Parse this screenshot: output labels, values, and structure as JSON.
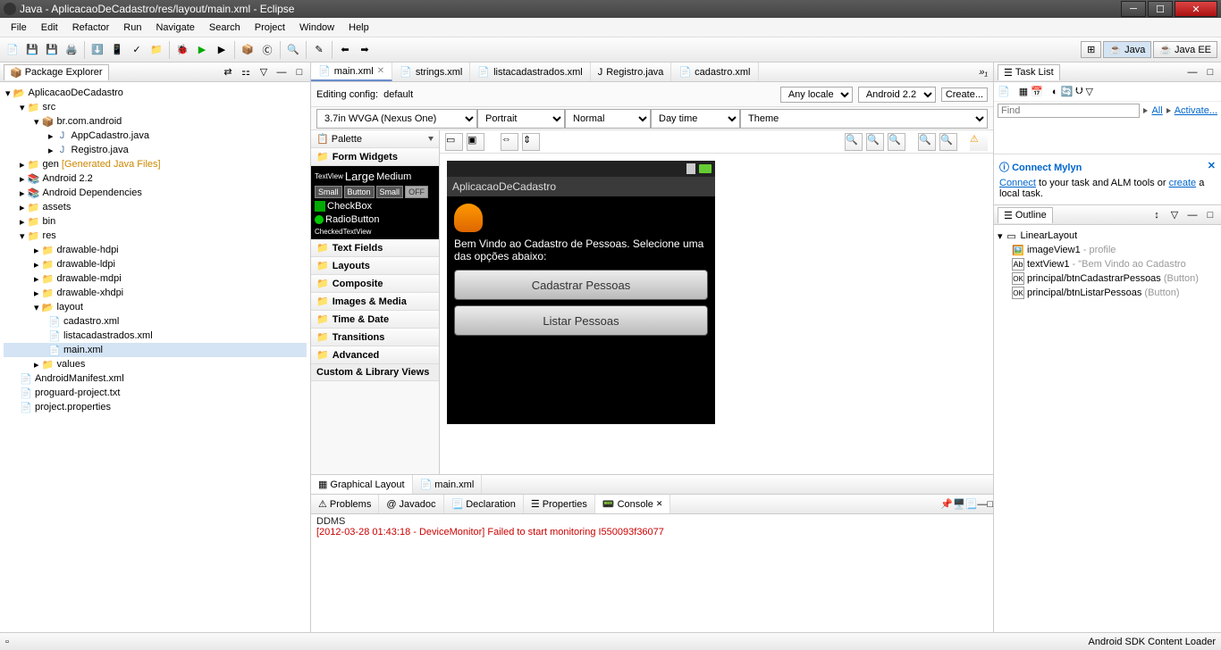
{
  "window": {
    "title": "Java - AplicacaoDeCadastro/res/layout/main.xml - Eclipse"
  },
  "menu": [
    "File",
    "Edit",
    "Refactor",
    "Run",
    "Navigate",
    "Search",
    "Project",
    "Window",
    "Help"
  ],
  "perspectives": {
    "java": "Java",
    "javaee": "Java EE"
  },
  "packageExplorer": {
    "title": "Package Explorer",
    "nodes": {
      "project": "AplicacaoDeCadastro",
      "src": "src",
      "pkg": "br.com.android",
      "file1": "AppCadastro.java",
      "file2": "Registro.java",
      "gen": "gen",
      "genSuffix": "[Generated Java Files]",
      "android22": "Android 2.2",
      "deps": "Android Dependencies",
      "assets": "assets",
      "bin": "bin",
      "res": "res",
      "hdpi": "drawable-hdpi",
      "ldpi": "drawable-ldpi",
      "mdpi": "drawable-mdpi",
      "xhdpi": "drawable-xhdpi",
      "layout": "layout",
      "cadastro": "cadastro.xml",
      "lista": "listacadastrados.xml",
      "mainxml": "main.xml",
      "values": "values",
      "manifest": "AndroidManifest.xml",
      "proguard": "proguard-project.txt",
      "props": "project.properties"
    }
  },
  "editorTabs": [
    {
      "label": "main.xml",
      "active": true
    },
    {
      "label": "strings.xml"
    },
    {
      "label": "listacadastrados.xml"
    },
    {
      "label": "Registro.java"
    },
    {
      "label": "cadastro.xml"
    }
  ],
  "editorConfig": {
    "label": "Editing config:",
    "value": "default",
    "locale": "Any locale",
    "target": "Android 2.2",
    "create": "Create...",
    "device": "3.7in WVGA (Nexus One)",
    "orient": "Portrait",
    "dock": "Normal",
    "daynight": "Day time",
    "theme": "Theme"
  },
  "palette": {
    "title": "Palette",
    "cats": [
      "Form Widgets",
      "Text Fields",
      "Layouts",
      "Composite",
      "Images & Media",
      "Time & Date",
      "Transitions",
      "Advanced",
      "Custom & Library Views"
    ],
    "widgets": {
      "textview": "TextView",
      "large": "Large",
      "medium": "Medium",
      "small": "Small",
      "button": "Button",
      "small2": "Small",
      "off": "OFF",
      "checkbox": "CheckBox",
      "radio": "RadioButton",
      "checked": "CheckedTextView"
    }
  },
  "device": {
    "appTitle": "AplicacaoDeCadastro",
    "welcome": "Bem Vindo ao Cadastro de Pessoas. Selecione uma das opções abaixo:",
    "btn1": "Cadastrar Pessoas",
    "btn2": "Listar Pessoas"
  },
  "bottomTabs": {
    "graphical": "Graphical Layout",
    "source": "main.xml"
  },
  "taskList": {
    "title": "Task List",
    "find": "Find",
    "all": "All",
    "activate": "Activate...",
    "connectTitle": "Connect Mylyn",
    "connectText1": "Connect",
    "connectText2": " to your task and ALM tools or ",
    "connectText3": "create",
    "connectText4": " a local task."
  },
  "outline": {
    "title": "Outline",
    "root": "LinearLayout",
    "image": "imageView1",
    "imageSuffix": " - profile",
    "text": "textView1",
    "textSuffix": " - \"Bem Vindo ao Cadastro",
    "btn1": "principal/btnCadastrarPessoas",
    "btn1Suffix": " (Button)",
    "btn2": "principal/btnListarPessoas",
    "btn2Suffix": " (Button)"
  },
  "bottomPanel": {
    "tabs": [
      "Problems",
      "Javadoc",
      "Declaration",
      "Properties",
      "Console"
    ],
    "consoleTitle": "DDMS",
    "consoleLine": "[2012-03-28 01:43:18 - DeviceMonitor] Failed to start monitoring I550093f36077"
  },
  "statusbar": {
    "right": "Android SDK Content Loader"
  }
}
